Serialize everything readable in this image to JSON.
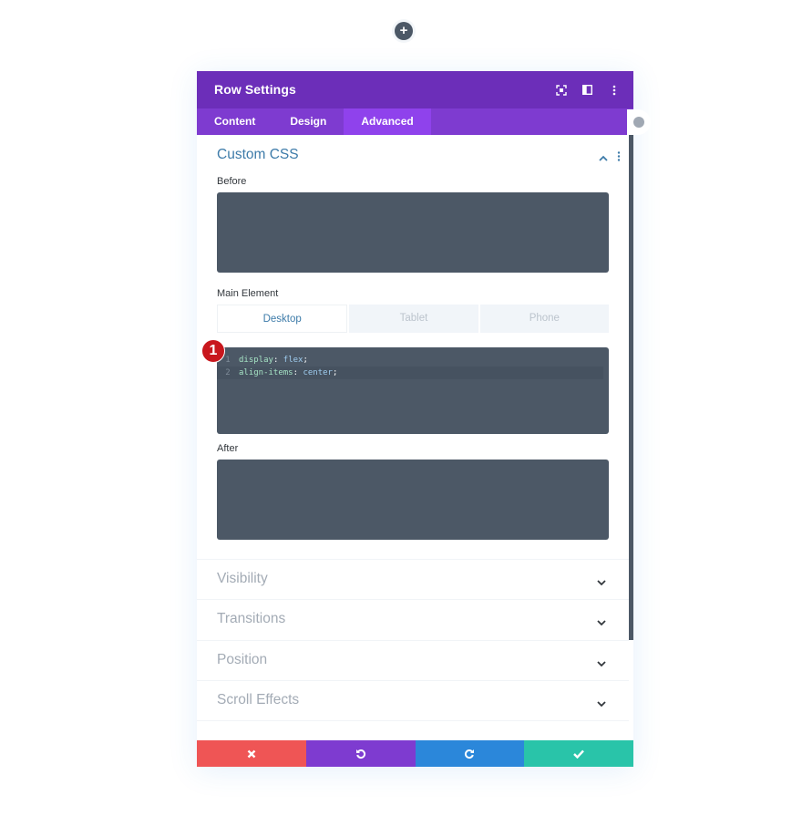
{
  "modal": {
    "title": "Row Settings",
    "header_icons": [
      "expand-icon",
      "split-view-icon",
      "more-options-icon"
    ],
    "tabs": [
      {
        "label": "Content",
        "active": false
      },
      {
        "label": "Design",
        "active": false
      },
      {
        "label": "Advanced",
        "active": true
      }
    ]
  },
  "custom_css": {
    "title": "Custom CSS",
    "before_label": "Before",
    "main_element_label": "Main Element",
    "device_tabs": [
      {
        "label": "Desktop",
        "active": true
      },
      {
        "label": "Tablet",
        "active": false
      },
      {
        "label": "Phone",
        "active": false
      }
    ],
    "code_lines": [
      {
        "num": "1",
        "prop": "display",
        "value": "flex"
      },
      {
        "num": "2",
        "prop": "align-items",
        "value": "center"
      }
    ],
    "after_label": "After"
  },
  "badge": "1",
  "sections": [
    {
      "title": "Visibility"
    },
    {
      "title": "Transitions"
    },
    {
      "title": "Position"
    },
    {
      "title": "Scroll Effects"
    }
  ],
  "footer": {
    "cancel": "cancel-icon",
    "undo": "undo-icon",
    "redo": "redo-icon",
    "save": "check-icon"
  },
  "colors": {
    "header": "#6c2eb9",
    "tabs": "#7e3bd0",
    "active_tab": "#8f42ec",
    "cancel": "#ef5555",
    "undo": "#7e3bd0",
    "redo": "#2b87da",
    "save": "#29c4a9",
    "editor": "#4c5866"
  }
}
